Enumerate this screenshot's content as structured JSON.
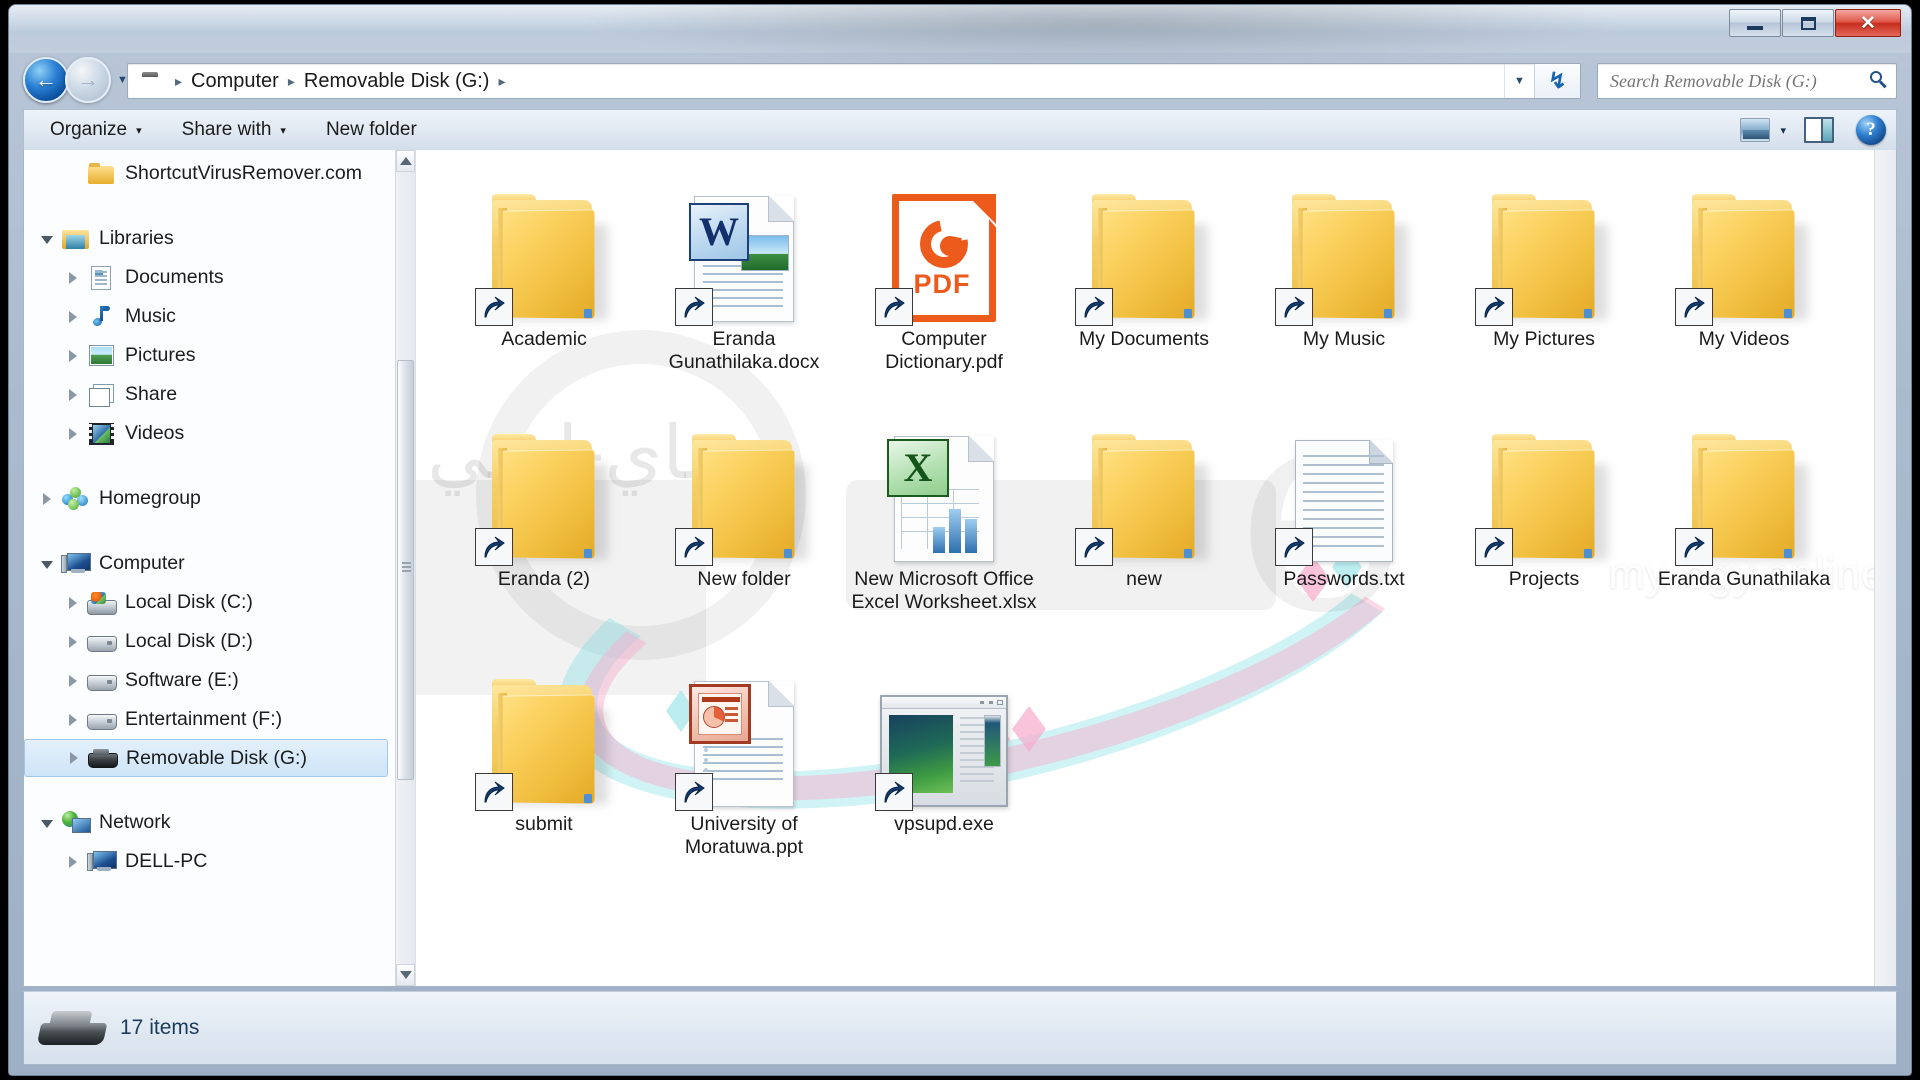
{
  "window": {
    "buttons": {
      "minimize": "minimize-button",
      "maximize": "maximize-button",
      "close": "✕"
    }
  },
  "nav": {
    "back_arrow": "←",
    "forward_arrow": "→",
    "history_caret": "▼",
    "breadcrumbs": [
      "Computer",
      "Removable Disk (G:)"
    ],
    "breadcrumb_separator": "▸",
    "address_dropdown": "▼",
    "refresh": "↻"
  },
  "search": {
    "placeholder": "Search Removable Disk (G:)",
    "value": ""
  },
  "toolbar": {
    "organize_label": "Organize",
    "share_with_label": "Share with",
    "new_folder_label": "New folder",
    "caret": "▾",
    "help_label": "?"
  },
  "sidebar": {
    "items": [
      {
        "label": "ShortcutVirusRemover.com",
        "icon": "folder-icon",
        "indent": 2,
        "twisty": "none",
        "selected": false
      },
      {
        "label": "Libraries",
        "icon": "libraries-icon",
        "indent": 1,
        "twisty": "open",
        "selected": false
      },
      {
        "label": "Documents",
        "icon": "documents-icon",
        "indent": 2,
        "twisty": "closed",
        "selected": false
      },
      {
        "label": "Music",
        "icon": "music-icon",
        "indent": 2,
        "twisty": "closed",
        "selected": false
      },
      {
        "label": "Pictures",
        "icon": "pictures-icon",
        "indent": 2,
        "twisty": "closed",
        "selected": false
      },
      {
        "label": "Share",
        "icon": "share-icon",
        "indent": 2,
        "twisty": "closed",
        "selected": false
      },
      {
        "label": "Videos",
        "icon": "videos-icon",
        "indent": 2,
        "twisty": "closed",
        "selected": false
      },
      {
        "label": "Homegroup",
        "icon": "homegroup-icon",
        "indent": 1,
        "twisty": "closed",
        "selected": false
      },
      {
        "label": "Computer",
        "icon": "computer-icon",
        "indent": 1,
        "twisty": "open",
        "selected": false
      },
      {
        "label": "Local Disk (C:)",
        "icon": "system-disk-icon",
        "indent": 2,
        "twisty": "closed",
        "selected": false
      },
      {
        "label": "Local Disk (D:)",
        "icon": "disk-icon",
        "indent": 2,
        "twisty": "closed",
        "selected": false
      },
      {
        "label": "Software (E:)",
        "icon": "disk-icon",
        "indent": 2,
        "twisty": "closed",
        "selected": false
      },
      {
        "label": "Entertainment (F:)",
        "icon": "disk-icon",
        "indent": 2,
        "twisty": "closed",
        "selected": false
      },
      {
        "label": "Removable Disk (G:)",
        "icon": "usb-disk-icon",
        "indent": 2,
        "twisty": "closed",
        "selected": true
      },
      {
        "label": "Network",
        "icon": "network-icon",
        "indent": 1,
        "twisty": "open",
        "selected": false
      },
      {
        "label": "DELL-PC",
        "icon": "computer-icon",
        "indent": 2,
        "twisty": "closed",
        "selected": false
      }
    ]
  },
  "files": {
    "rows": [
      [
        {
          "name": "Academic",
          "type": "folder",
          "shortcut": true
        },
        {
          "name": "Eranda Gunathilaka.docx",
          "type": "word",
          "shortcut": true
        },
        {
          "name": "Computer Dictionary.pdf",
          "type": "pdf",
          "shortcut": true
        },
        {
          "name": "My Documents",
          "type": "folder",
          "shortcut": true
        },
        {
          "name": "My Music",
          "type": "folder",
          "shortcut": true
        },
        {
          "name": "My Pictures",
          "type": "folder",
          "shortcut": true
        },
        {
          "name": "My Videos",
          "type": "folder",
          "shortcut": true
        }
      ],
      [
        {
          "name": "Eranda (2)",
          "type": "folder",
          "shortcut": true
        },
        {
          "name": "New folder",
          "type": "folder",
          "shortcut": true
        },
        {
          "name": "New Microsoft Office Excel Worksheet.xlsx",
          "type": "excel",
          "shortcut": false
        },
        {
          "name": "new",
          "type": "folder",
          "shortcut": true
        },
        {
          "name": "Passwords.txt",
          "type": "text",
          "shortcut": true
        },
        {
          "name": "Projects",
          "type": "folder",
          "shortcut": true
        },
        {
          "name": "Eranda Gunathilaka",
          "type": "folder",
          "shortcut": true
        }
      ],
      [
        {
          "name": "submit",
          "type": "folder",
          "shortcut": true
        },
        {
          "name": "University of Moratuwa.ppt",
          "type": "powerpoint",
          "shortcut": true
        },
        {
          "name": "vpsupd.exe",
          "type": "exe",
          "shortcut": true
        }
      ]
    ]
  },
  "status": {
    "item_count": "17 items",
    "drive_icon": "removable-disk-icon"
  },
  "watermarks": {
    "arabic": "ماي-ايجي",
    "site": "my-egy.online",
    "letter": "e"
  },
  "colors": {
    "accent_blue": "#1763ad",
    "selection_blue": "#cfe5f8",
    "pdf_orange": "#ec5a1c",
    "word_blue": "#12306b",
    "excel_green": "#14541a",
    "ppt_red": "#a33a22",
    "folder_yellow": "#f0bd3c",
    "close_red": "#c62c1c",
    "status_text": "#1b3b5c"
  }
}
